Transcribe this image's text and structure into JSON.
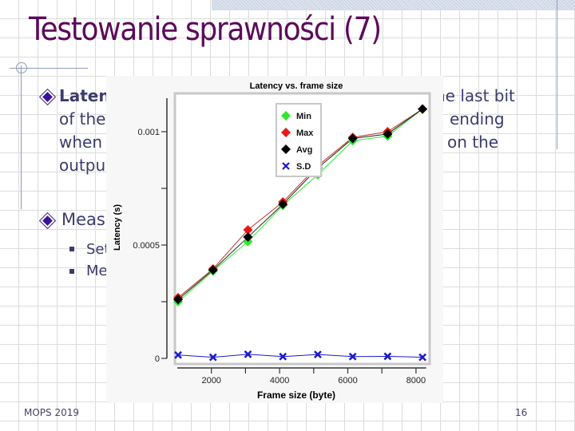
{
  "slide": {
    "title": "Testowanie sprawności (7)",
    "bullets": [
      {
        "lead_bold": "Laten",
        "line1_right": "he last bit",
        "line2_left": "of the",
        "line2_right": "ending",
        "line3_left": "when",
        "line3_right": "on the",
        "line4_left": "outpu"
      },
      {
        "lead": "Meas",
        "sub_items": [
          "Set",
          "Me"
        ]
      }
    ],
    "footer_left": "MOPS 2019",
    "page_number": "16"
  },
  "colors": {
    "title": "#5c0a5a",
    "body_text": "#3b3b6e",
    "min": "#2ee82e",
    "max": "#e81818",
    "avg": "#000000",
    "sd": "#1a1acc"
  },
  "chart_data": {
    "type": "line",
    "title": "Latency vs. frame size",
    "xlabel": "Frame size (byte)",
    "ylabel": "Latency (s)",
    "x": [
      1024,
      2048,
      3072,
      4096,
      5120,
      6144,
      7168,
      8192
    ],
    "xlim": [
      1000,
      8300
    ],
    "ylim": [
      0,
      0.00112
    ],
    "xticks": [
      2000,
      3000,
      4000,
      5000,
      6000,
      7000,
      8000
    ],
    "xtick_labels": [
      "2000",
      "",
      "4000",
      "",
      "6000",
      "",
      "8000"
    ],
    "yticks": [
      0,
      0.00025,
      0.0005,
      0.00075,
      0.001
    ],
    "ytick_labels": [
      "0",
      "",
      "0.0005",
      "",
      "0.001"
    ],
    "grid": false,
    "legend_position": "top-center",
    "series": [
      {
        "name": "Min",
        "marker": "diamond",
        "values": [
          0.00025,
          0.000385,
          0.000515,
          0.000675,
          0.00081,
          0.00096,
          0.00098,
          0.0011
        ]
      },
      {
        "name": "Max",
        "marker": "diamond",
        "values": [
          0.000268,
          0.000395,
          0.000567,
          0.00069,
          0.00085,
          0.000975,
          0.001,
          0.0011
        ]
      },
      {
        "name": "Avg",
        "marker": "diamond",
        "values": [
          0.00026,
          0.00039,
          0.000535,
          0.00068,
          0.00084,
          0.00097,
          0.00099,
          0.0011
        ]
      },
      {
        "name": "S.D.",
        "marker": "x",
        "values": [
          1.5e-05,
          5e-06,
          1.8e-05,
          8e-06,
          1.7e-05,
          8e-06,
          9e-06,
          5e-06
        ]
      }
    ]
  }
}
